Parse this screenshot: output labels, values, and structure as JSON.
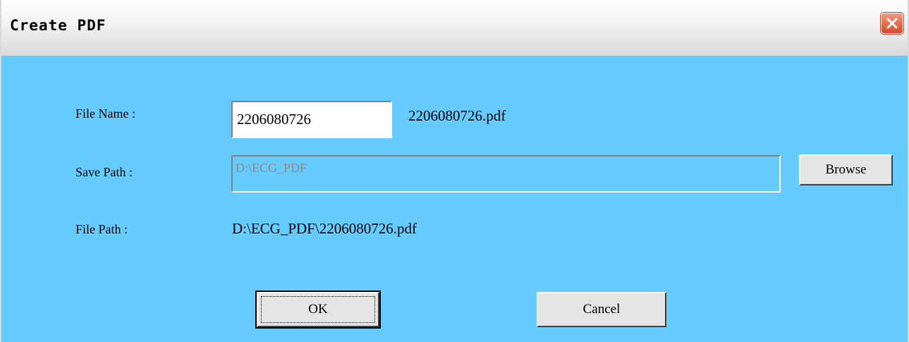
{
  "window": {
    "title": "Create PDF"
  },
  "form": {
    "file_name_label": "File Name :",
    "file_name_value": "2206080726",
    "file_name_preview": "2206080726.pdf",
    "save_path_label": "Save Path :",
    "save_path_value": "D:\\ECG_PDF",
    "browse_label": "Browse",
    "file_path_label": "File Path :",
    "file_path_value": "D:\\ECG_PDF\\2206080726.pdf"
  },
  "buttons": {
    "ok_label": "OK",
    "cancel_label": "Cancel"
  },
  "colors": {
    "dialog_bg": "#66ccff",
    "close_red": "#d9482a"
  }
}
